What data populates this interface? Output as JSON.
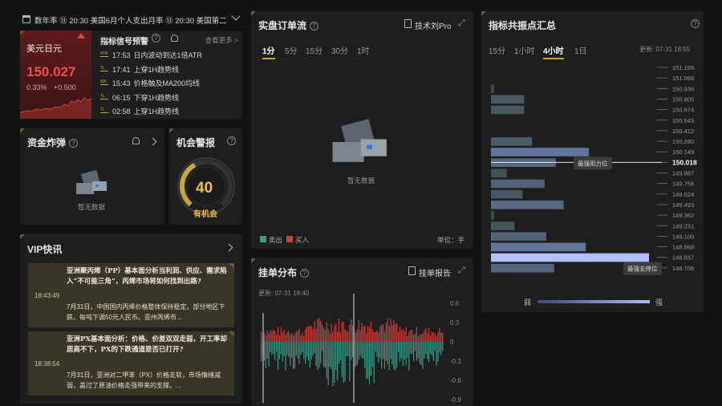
{
  "ticker": {
    "text": "数年率 ⑬ 20:30 美国6月个人支出月率 ⑬ 20:30 美国第二季"
  },
  "quote": {
    "name": "美元日元",
    "price": "150.027",
    "pct": "0.33%",
    "change": "+0.500",
    "up_color": "#e0443c"
  },
  "alerts": {
    "title": "指标信号预警",
    "more": "查看更多 >",
    "items": [
      {
        "tag": "ATR",
        "time": "17:53",
        "text": "日内波动到达1倍ATR"
      },
      {
        "tag": "TL",
        "time": "17:41",
        "text": "上穿1H趋势线"
      },
      {
        "tag": "MA",
        "time": "15:43",
        "text": "价格触及MA200均线"
      },
      {
        "tag": "TL",
        "time": "06:15",
        "text": "下穿1H趋势线"
      },
      {
        "tag": "TL",
        "time": "02:58",
        "text": "上穿1H趋势线"
      }
    ]
  },
  "bomb": {
    "title": "资金炸弹",
    "empty": "暂无数据"
  },
  "chance": {
    "title": "机会警报",
    "score": "40",
    "label": "有机会",
    "level": 0.4
  },
  "vip": {
    "title": "VIP快讯",
    "items": [
      {
        "time": "18:43:49",
        "headline": "亚洲聚丙烯（PP）基本面分析当利润、供应、需求陷入“不可能三角”，丙烯市场将如何找到出路?",
        "body": "7月31日，中国国内丙烯价格整体保持稳定，部分地区下跌，每吨下调50元人民币。亚州丙烯市..."
      },
      {
        "time": "18:38:54",
        "headline": "亚洲PX基本面分析：价格、价差双双走弱，开工率却居高不下，PX的下跌通道是否已打开?",
        "body": "7月31日，亚洲对二甲苯（PX）价格走软，市场情绪减弱，盖过了原油价格走强带来的支撑。..."
      }
    ]
  },
  "orderflow": {
    "title": "实盘订单流",
    "link": "技术刘Pro",
    "tabs": [
      "1分",
      "5分",
      "15分",
      "30分",
      "1时"
    ],
    "active_tab": 0,
    "empty": "暂无数据",
    "legend_sell": "卖出",
    "legend_buy": "买入",
    "unit": "单位：手",
    "sell_color": "#3f9a8a",
    "buy_color": "#c8433f"
  },
  "distribution": {
    "title": "挂单分布",
    "link": "挂单报告",
    "updated": "更新: 07-31 18:40",
    "axis": [
      "0.6",
      "0.3",
      "0",
      "-0.3",
      "-0.6",
      "-0.9"
    ]
  },
  "resonance": {
    "title": "指标共振点汇总",
    "tabs": [
      "15分",
      "1小时",
      "4小时",
      "1日"
    ],
    "active_tab": 2,
    "updated": "更新:  07-31 18:55",
    "current_price": "150.018",
    "resistance_label": "最强阻力位",
    "support_label": "最强支撑位",
    "weak": "弱",
    "strong": "强",
    "levels": [
      "151.199",
      "151.068",
      "150.936",
      "150.805",
      "150.674",
      "150.543",
      "150.412",
      "150.280",
      "150.149",
      "150.018",
      "149.887",
      "149.756",
      "149.624",
      "149.493",
      "149.362",
      "149.231",
      "149.100",
      "148.968",
      "148.837",
      "148.706"
    ],
    "strengths": [
      0,
      0,
      0.02,
      0.21,
      0.21,
      0,
      0,
      0.26,
      0.62,
      0.41,
      0.1,
      0.34,
      0.2,
      0.46,
      0.02,
      0.15,
      0.35,
      0.6,
      1.0,
      0.4
    ]
  }
}
